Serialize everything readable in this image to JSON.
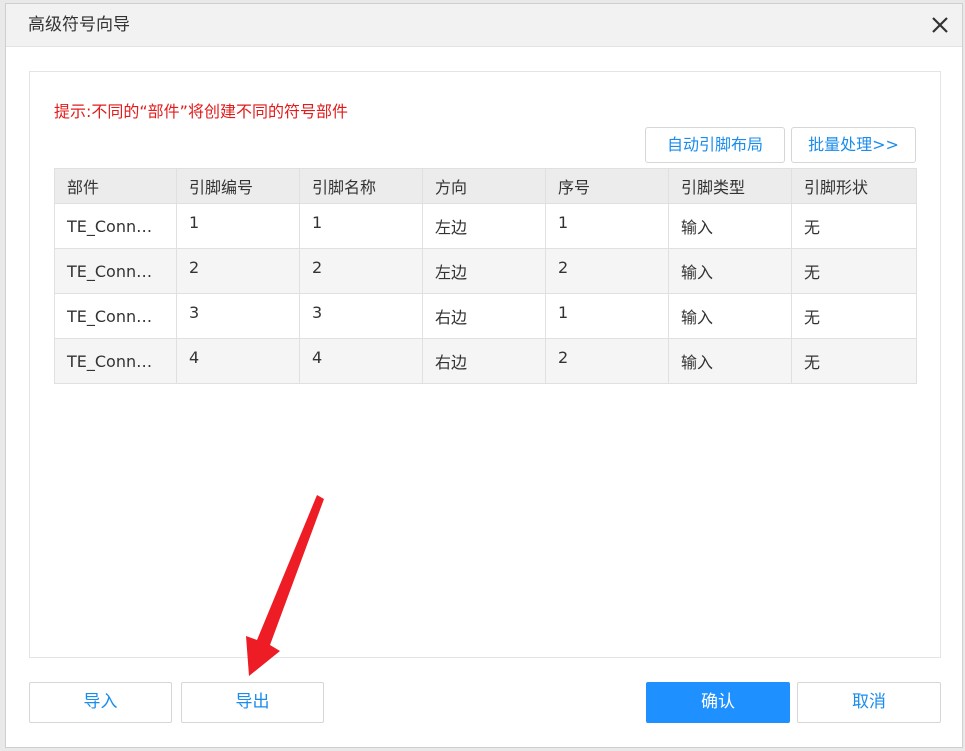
{
  "dialog": {
    "title": "高级符号向导",
    "close_icon": "close-icon"
  },
  "panel": {
    "hint": "提示:不同的“部件”将创建不同的符号部件",
    "auto_layout_label": "自动引脚布局",
    "batch_label": "批量处理>>"
  },
  "table": {
    "headers": [
      "部件",
      "引脚编号",
      "引脚名称",
      "方向",
      "序号",
      "引脚类型",
      "引脚形状"
    ],
    "rows": [
      [
        "TE_Conn…",
        "1",
        "1",
        "左边",
        "1",
        "输入",
        "无"
      ],
      [
        "TE_Conn…",
        "2",
        "2",
        "左边",
        "2",
        "输入",
        "无"
      ],
      [
        "TE_Conn…",
        "3",
        "3",
        "右边",
        "1",
        "输入",
        "无"
      ],
      [
        "TE_Conn…",
        "4",
        "4",
        "右边",
        "2",
        "输入",
        "无"
      ]
    ]
  },
  "footer": {
    "import_label": "导入",
    "export_label": "导出",
    "ok_label": "确认",
    "cancel_label": "取消"
  },
  "colors": {
    "accent": "#1e90ff",
    "link": "#1a8cec",
    "hint": "#e21b1b",
    "annotation_arrow": "#ee1c25"
  },
  "annotation": {
    "icon": "red-arrow-icon",
    "target": "export-button"
  }
}
